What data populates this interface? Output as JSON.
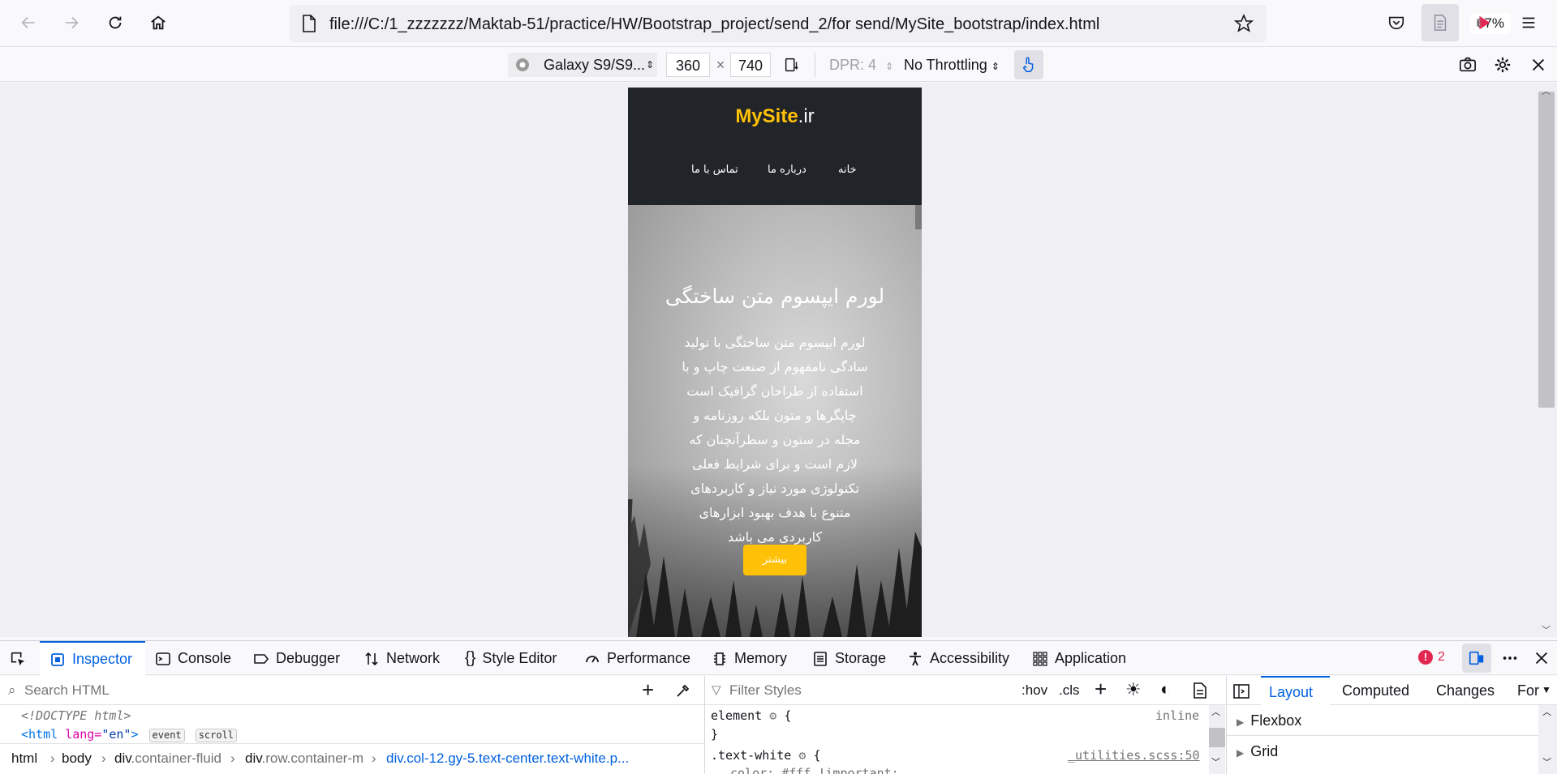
{
  "browser": {
    "url": "file:///C:/1_zzzzzzz/Maktab-51/practice/HW/Bootstrap_project/send_2/for send/MySite_bootstrap/index.html",
    "zoom": "67%"
  },
  "rdm": {
    "device": "Galaxy S9/S9...",
    "width": "360",
    "times": "×",
    "height": "740",
    "dpr": "DPR: 4",
    "throttling": "No Throttling"
  },
  "site": {
    "brand_main": "MySite",
    "brand_tld": ".ir",
    "nav": [
      "خانه",
      "درباره ما",
      "تماس با ما"
    ],
    "hero_title": "لورم ایپسوم متن ساختگی",
    "hero_lines": [
      "لورم ایپسوم متن ساختگی با تولید",
      "سادگی نامفهوم از صنعت چاپ و با",
      "استفاده از طراحان گرافیک است",
      "چاپگرها و متون بلکه روزنامه و",
      "مجله در ستون و سطرآنچنان که",
      "لازم است و برای شرایط فعلی",
      "تکنولوژی مورد نیاز و کاربردهای",
      "متنوع با هدف بهبود ابزارهای",
      "کاربردی می باشد"
    ],
    "hero_button": "بیشتر"
  },
  "devtools": {
    "tabs": [
      "Inspector",
      "Console",
      "Debugger",
      "Network",
      "Style Editor",
      "Performance",
      "Memory",
      "Storage",
      "Accessibility",
      "Application"
    ],
    "error_count": "2",
    "search_placeholder": "Search HTML",
    "html_line1": "<!DOCTYPE html>",
    "html_tag": "<html",
    "html_attr": "lang=",
    "html_attr_val": "\"en\"",
    "html_close": ">",
    "badge_event": "event",
    "badge_scroll": "scroll",
    "breadcrumbs": [
      {
        "tag": "html",
        "cls": ""
      },
      {
        "tag": "body",
        "cls": ""
      },
      {
        "tag": "div",
        "cls": ".container-fluid"
      },
      {
        "tag": "div",
        "cls": ".row.container-m"
      },
      {
        "tag": "div.col-12.gy-5.text-center.text-white.p...",
        "cls": ""
      }
    ],
    "filter_placeholder": "Filter Styles",
    "hov": ":hov",
    "cls": ".cls",
    "rule1_selector": "element",
    "rule1_open": "{",
    "rule1_close": "}",
    "rule1_source": "inline",
    "rule2_selector": ".text-white",
    "rule2_source": "_utilities.scss:50",
    "rule2_partial": "color: #fff !important;",
    "right_tabs": [
      "Layout",
      "Computed",
      "Changes",
      "For"
    ],
    "layout_sections": [
      "Flexbox",
      "Grid"
    ]
  }
}
